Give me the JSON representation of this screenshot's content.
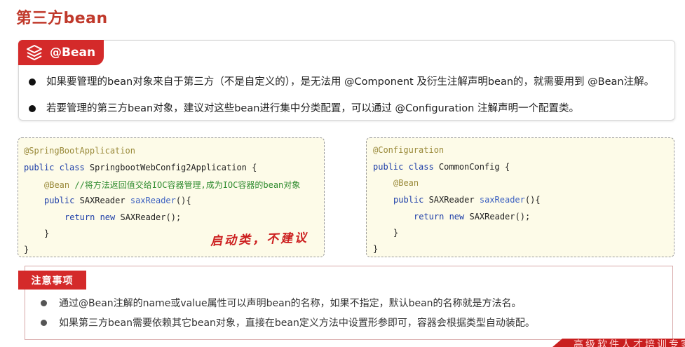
{
  "page": {
    "title": "第三方bean"
  },
  "bean_section": {
    "tag_label": "@Bean",
    "tag_icon": "layers-icon",
    "accent_color": "#d42a2a",
    "bullets": [
      "如果要管理的bean对象来自于第三方（不是自定义的），是无法用 @Component 及衍生注解声明bean的，就需要用到 @Bean注解。",
      "若要管理的第三方bean对象，建议对这些bean进行集中分类配置，可以通过 @Configuration 注解声明一个配置类。"
    ]
  },
  "code_left": {
    "l1": "@SpringBootApplication",
    "l2_kw": "public class",
    "l2_name": " SpringbootWebConfig2Application {",
    "l3_anno": "@Bean",
    "l3_comment": " //将方法返回值交给IOC容器管理,成为IOC容器的bean对象",
    "l4_kw": "public",
    "l4_type": " SAXReader ",
    "l4_fn": "saxReader",
    "l4_end": "(){",
    "l5_kw": "return new",
    "l5_rest": " SAXReader();",
    "l6": "}",
    "l7": "}"
  },
  "code_right": {
    "l1": "@Configuration",
    "l2_kw": "public class",
    "l2_name": " CommonConfig {",
    "l3_anno": "@Bean",
    "l4_kw": "public",
    "l4_type": " SAXReader ",
    "l4_fn": "saxReader",
    "l4_end": "(){",
    "l5_kw": "return new",
    "l5_rest": " SAXReader();",
    "l6": "}",
    "l7": "}"
  },
  "stamp_text": "启动类，不建议",
  "notes": {
    "tag_label": "注意事项",
    "bullets": [
      "通过@Bean注解的name或value属性可以声明bean的名称，如果不指定，默认bean的名称就是方法名。",
      "如果第三方bean需要依赖其它bean对象，直接在bean定义方法中设置形参即可，容器会根据类型自动装配。"
    ]
  },
  "footer": {
    "text": "高级软件人才培训专家"
  }
}
